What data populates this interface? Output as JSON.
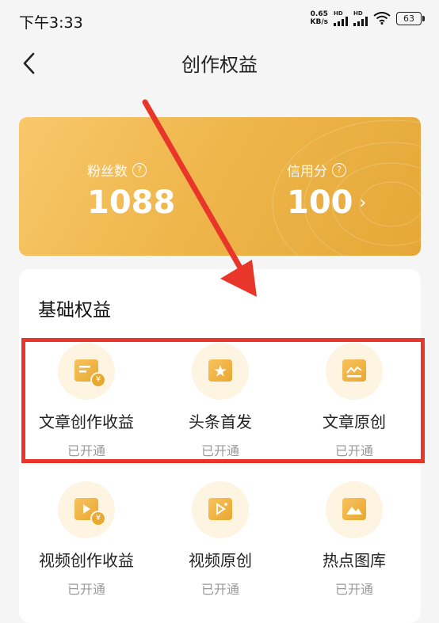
{
  "status_bar": {
    "time": "下午3:33",
    "net_speed_value": "0.65",
    "net_speed_unit": "KB/s",
    "signal1_label": "HD",
    "signal2_label": "HD",
    "battery": "63"
  },
  "header": {
    "title": "创作权益",
    "back_icon": "chevron-left-icon"
  },
  "stats": {
    "fans_label": "粉丝数",
    "fans_value": "1088",
    "credit_label": "信用分",
    "credit_value": "100",
    "help_glyph": "?",
    "arrow_glyph": "›"
  },
  "section": {
    "title": "基础权益",
    "items": [
      {
        "name": "文章创作收益",
        "status": "已开通",
        "icon": "article-income-icon"
      },
      {
        "name": "头条首发",
        "status": "已开通",
        "icon": "star-icon"
      },
      {
        "name": "文章原创",
        "status": "已开通",
        "icon": "chart-icon"
      },
      {
        "name": "视频创作收益",
        "status": "已开通",
        "icon": "video-income-icon"
      },
      {
        "name": "视频原创",
        "status": "已开通",
        "icon": "video-play-icon"
      },
      {
        "name": "热点图库",
        "status": "已开通",
        "icon": "image-icon"
      }
    ]
  },
  "colors": {
    "accent_gold": "#efb64c",
    "annotation_red": "#e8372a"
  }
}
